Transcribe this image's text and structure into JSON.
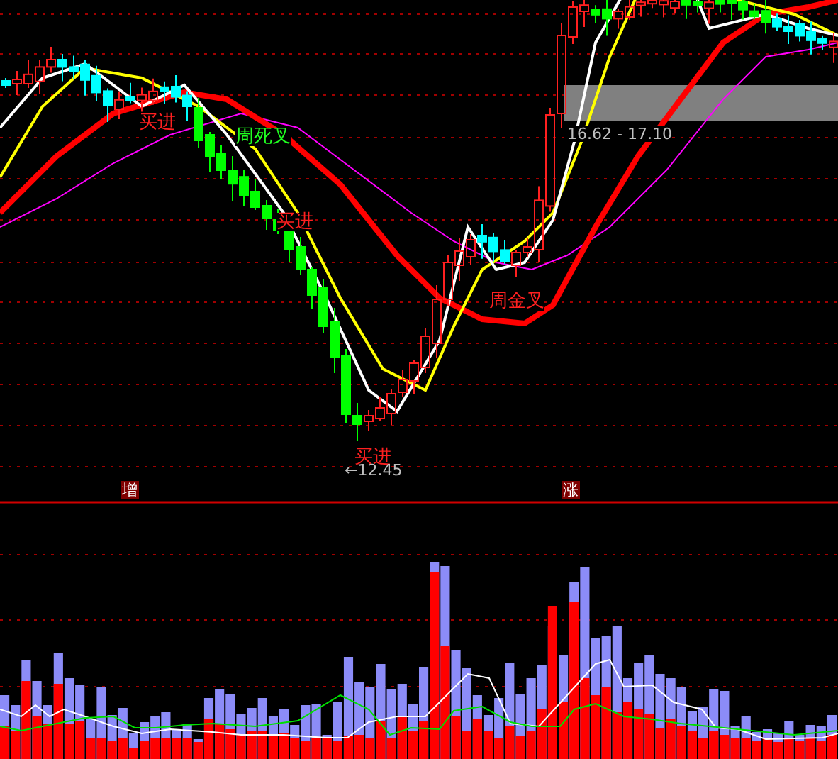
{
  "price_panel": {
    "signals": [
      {
        "text": "买进",
        "kind": "buy"
      },
      {
        "text": "周死叉",
        "kind": "death_cross"
      },
      {
        "text": "买进",
        "kind": "buy"
      },
      {
        "text": "周金叉",
        "kind": "golden_cross"
      },
      {
        "text": "买进",
        "kind": "buy"
      }
    ],
    "low_marker": "←12.45",
    "range_label": "16.62 - 17.10"
  },
  "divider_labels": [
    "增",
    "涨"
  ]
}
